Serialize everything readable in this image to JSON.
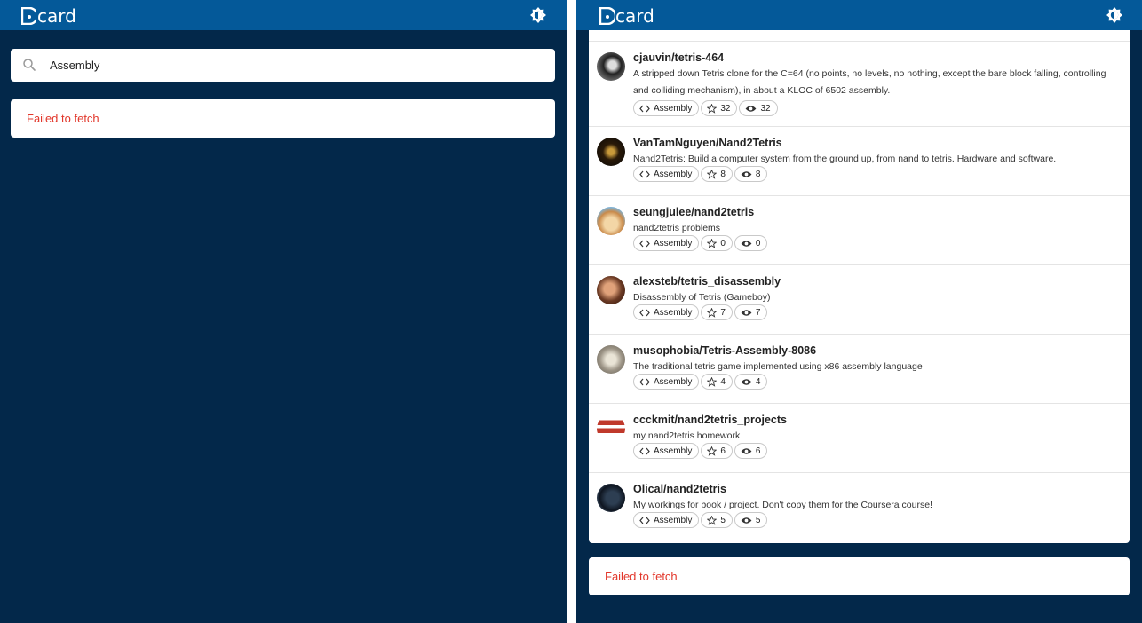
{
  "app": {
    "logo_text": "card"
  },
  "left": {
    "search": {
      "value": "Assembly",
      "placeholder": ""
    },
    "error": "Failed to fetch"
  },
  "right": {
    "repos": [
      {
        "name": "cjauvin/tetris-464",
        "description": "A stripped down Tetris clone for the C=64 (no points, no levels, no nothing, except the bare block falling, controlling and colliding mechanism), in about a KLOC of 6502 assembly.",
        "language": "Assembly",
        "stars": "32",
        "watchers": "32"
      },
      {
        "name": "VanTamNguyen/Nand2Tetris",
        "description": "Nand2Tetris: Build a computer system from the ground up, from nand to tetris. Hardware and software.",
        "language": "Assembly",
        "stars": "8",
        "watchers": "8"
      },
      {
        "name": "seungjulee/nand2tetris",
        "description": "nand2tetris problems",
        "language": "Assembly",
        "stars": "0",
        "watchers": "0"
      },
      {
        "name": "alexsteb/tetris_disassembly",
        "description": "Disassembly of Tetris (Gameboy)",
        "language": "Assembly",
        "stars": "7",
        "watchers": "7"
      },
      {
        "name": "musophobia/Tetris-Assembly-8086",
        "description": "The traditional tetris game implemented using x86 assembly language",
        "language": "Assembly",
        "stars": "4",
        "watchers": "4"
      },
      {
        "name": "ccckmit/nand2tetris_projects",
        "description": "my nand2tetris homework",
        "language": "Assembly",
        "stars": "6",
        "watchers": "6"
      },
      {
        "name": "Olical/nand2tetris",
        "description": "My workings for book / project. Don't copy them for the Coursera course!",
        "language": "Assembly",
        "stars": "5",
        "watchers": "5"
      }
    ],
    "error": "Failed to fetch"
  },
  "icons": {
    "theme": "brightness-icon",
    "search": "search-icon",
    "code": "code-icon",
    "star": "star-icon",
    "watch": "eye-icon"
  },
  "colors": {
    "header": "#045999",
    "background": "#03284a",
    "error": "#e2372b"
  }
}
